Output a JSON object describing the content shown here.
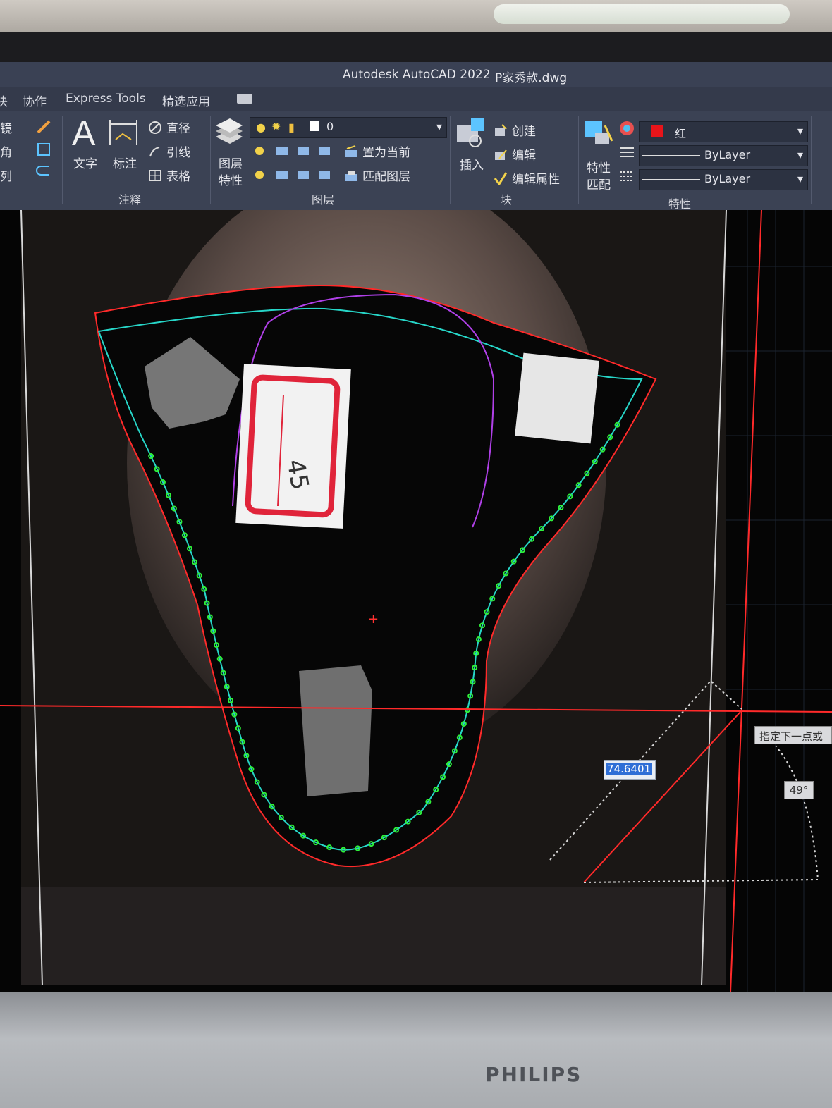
{
  "window": {
    "app_title": "Autodesk AutoCAD 2022",
    "file_name": "P家秀款.dwg"
  },
  "tabs": [
    {
      "label": "块"
    },
    {
      "label": "协作"
    },
    {
      "label": "Express Tools"
    },
    {
      "label": "精选应用"
    }
  ],
  "ribbon": {
    "left_stub": [
      "镜",
      "角",
      "列"
    ],
    "annotation": {
      "text_label": "文字",
      "dimension_label": "标注",
      "diameter_label": "直径",
      "leader_label": "引线",
      "table_label": "表格",
      "panel_label": "注释"
    },
    "layers": {
      "layer_properties_line1": "图层",
      "layer_properties_line2": "特性",
      "current_layer": "0",
      "set_current_label": "置为当前",
      "match_layer_label": "匹配图层",
      "panel_label": "图层"
    },
    "block": {
      "insert_label": "插入",
      "create_label": "创建",
      "edit_label": "编辑",
      "edit_attributes_label": "编辑属性",
      "panel_label": "块"
    },
    "properties": {
      "match_line1": "特性",
      "match_line2": "匹配",
      "color_value": "红",
      "linetype_value": "ByLayer",
      "lineweight_value": "ByLayer",
      "panel_label": "特性"
    }
  },
  "canvas": {
    "dynamic_input_value": "74.6401",
    "prompt_tooltip": "指定下一点或",
    "angle_value": "49°",
    "label_sticker_text": "45"
  },
  "monitor": {
    "brand": "PHILIPS"
  },
  "colors": {
    "outline_red": "#ff2a2a",
    "seam_cyan": "#27d6c8",
    "points_green": "#2ef03a",
    "curve_purple": "#b040e8",
    "ribbon_bg": "#3b4254"
  }
}
